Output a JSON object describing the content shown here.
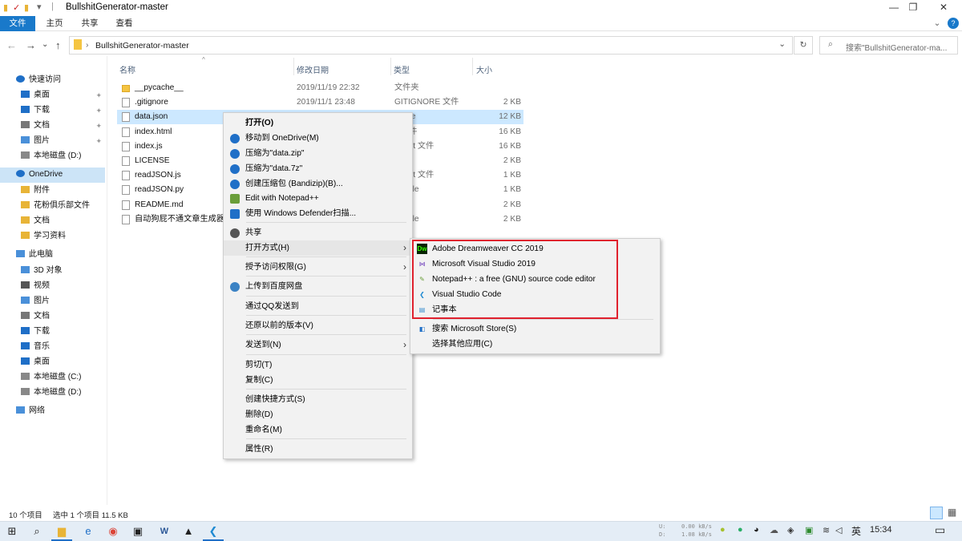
{
  "window": {
    "title": "BullshitGenerator-master",
    "minimize": "—",
    "maximize": "❐",
    "close": "✕"
  },
  "ribbon": {
    "tabs": [
      "文件",
      "主页",
      "共享",
      "查看"
    ],
    "expand": "⌄",
    "help": "?"
  },
  "address": {
    "back": "←",
    "forward": "→",
    "recent": "⌄",
    "up": "↑",
    "path": "BullshitGenerator-master",
    "dropdown": "⌄",
    "refresh": "↻",
    "search_placeholder": "搜索\"BullshitGenerator-ma..."
  },
  "sidebar": {
    "items": [
      {
        "label": "快速访问",
        "icon": "star-icon",
        "pinned": false,
        "level": 0
      },
      {
        "label": "桌面",
        "icon": "desktop-icon",
        "pinned": true,
        "level": 1
      },
      {
        "label": "下载",
        "icon": "download-icon",
        "pinned": true,
        "level": 1
      },
      {
        "label": "文档",
        "icon": "document-icon",
        "pinned": true,
        "level": 1
      },
      {
        "label": "图片",
        "icon": "picture-icon",
        "pinned": true,
        "level": 1
      },
      {
        "label": "本地磁盘 (D:)",
        "icon": "drive-icon",
        "pinned": false,
        "level": 1
      },
      {
        "label": "OneDrive",
        "icon": "cloud-icon",
        "pinned": false,
        "level": 0,
        "selected": true
      },
      {
        "label": "附件",
        "icon": "folder-icon",
        "pinned": false,
        "level": 1
      },
      {
        "label": "花粉俱乐部文件",
        "icon": "folder-icon",
        "pinned": false,
        "level": 1
      },
      {
        "label": "文档",
        "icon": "folder-icon",
        "pinned": false,
        "level": 1
      },
      {
        "label": "学习资料",
        "icon": "folder-icon",
        "pinned": false,
        "level": 1
      },
      {
        "label": "此电脑",
        "icon": "computer-icon",
        "pinned": false,
        "level": 0
      },
      {
        "label": "3D 对象",
        "icon": "cube-icon",
        "pinned": false,
        "level": 1
      },
      {
        "label": "视频",
        "icon": "video-icon",
        "pinned": false,
        "level": 1
      },
      {
        "label": "图片",
        "icon": "picture-icon",
        "pinned": false,
        "level": 1
      },
      {
        "label": "文档",
        "icon": "document-icon",
        "pinned": false,
        "level": 1
      },
      {
        "label": "下载",
        "icon": "download-icon",
        "pinned": false,
        "level": 1
      },
      {
        "label": "音乐",
        "icon": "music-icon",
        "pinned": false,
        "level": 1
      },
      {
        "label": "桌面",
        "icon": "desktop-icon",
        "pinned": false,
        "level": 1
      },
      {
        "label": "本地磁盘 (C:)",
        "icon": "drive-icon",
        "pinned": false,
        "level": 1
      },
      {
        "label": "本地磁盘 (D:)",
        "icon": "drive-icon",
        "pinned": false,
        "level": 1
      },
      {
        "label": "网络",
        "icon": "network-icon",
        "pinned": false,
        "level": 0
      }
    ]
  },
  "columns": {
    "name": "名称",
    "date": "修改日期",
    "type": "类型",
    "size": "大小"
  },
  "files": [
    {
      "name": "__pycache__",
      "date": "2019/11/19 22:32",
      "type": "文件夹",
      "size": "",
      "folder": true
    },
    {
      "name": ".gitignore",
      "date": "2019/11/1 23:48",
      "type": "GITIGNORE 文件",
      "size": "2 KB"
    },
    {
      "name": "data.json",
      "date": "",
      "type": "N File",
      "size": "12 KB",
      "selected": true
    },
    {
      "name": "index.html",
      "date": "",
      "type": "L 文件",
      "size": "16 KB"
    },
    {
      "name": "index.js",
      "date": "",
      "type": "Script 文件",
      "size": "16 KB"
    },
    {
      "name": "LICENSE",
      "date": "",
      "type": "",
      "size": "2 KB"
    },
    {
      "name": "readJSON.js",
      "date": "",
      "type": "Script 文件",
      "size": "1 KB"
    },
    {
      "name": "readJSON.py",
      "date": "",
      "type": "on File",
      "size": "1 KB"
    },
    {
      "name": "README.md",
      "date": "",
      "type": "文件",
      "size": "2 KB"
    },
    {
      "name": "自动狗屁不通文章生成器",
      "date": "",
      "type": "on File",
      "size": "2 KB"
    }
  ],
  "context_menu": {
    "items": [
      {
        "label": "打开(O)",
        "bold": true,
        "icon": ""
      },
      {
        "label": "移动到 OneDrive(M)",
        "icon": "onedrive-icon"
      },
      {
        "label": "压缩为\"data.zip\"",
        "icon": "bandizip-icon"
      },
      {
        "label": "压缩为\"data.7z\"",
        "icon": "bandizip-icon"
      },
      {
        "label": "创建压缩包 (Bandizip)(B)...",
        "icon": "bandizip-icon"
      },
      {
        "label": "Edit with Notepad++",
        "icon": "notepadpp-icon"
      },
      {
        "label": "使用 Windows Defender扫描...",
        "icon": "defender-icon"
      },
      {
        "label": "共享",
        "icon": "share-icon",
        "sep_before": true
      },
      {
        "label": "打开方式(H)",
        "submenu": true,
        "hover": true
      },
      {
        "label": "授予访问权限(G)",
        "submenu": true,
        "sep_before": true
      },
      {
        "label": "上传到百度网盘",
        "icon": "baidu-icon",
        "sep_before": true
      },
      {
        "label": "通过QQ发送到",
        "sep_before": true
      },
      {
        "label": "还原以前的版本(V)",
        "sep_before": true
      },
      {
        "label": "发送到(N)",
        "submenu": true,
        "sep_before": true
      },
      {
        "label": "剪切(T)",
        "sep_before": true
      },
      {
        "label": "复制(C)"
      },
      {
        "label": "创建快捷方式(S)",
        "sep_before": true
      },
      {
        "label": "删除(D)"
      },
      {
        "label": "重命名(M)"
      },
      {
        "label": "属性(R)",
        "sep_before": true
      }
    ],
    "submenu_arrow": "›"
  },
  "open_with": {
    "items": [
      {
        "label": "Adobe Dreamweaver CC 2019",
        "icon": "dreamweaver-icon",
        "glyph": "Dw"
      },
      {
        "label": "Microsoft Visual Studio 2019",
        "icon": "visual-studio-icon",
        "glyph": "⋈"
      },
      {
        "label": "Notepad++ : a free (GNU) source code editor",
        "icon": "notepadpp-icon",
        "glyph": "✎"
      },
      {
        "label": "Visual Studio Code",
        "icon": "vscode-icon",
        "glyph": "❮"
      },
      {
        "label": "记事本",
        "icon": "notepad-icon",
        "glyph": "▤"
      },
      {
        "label": "搜索 Microsoft Store(S)",
        "icon": "store-icon",
        "glyph": "◧",
        "sep_before": true
      },
      {
        "label": "选择其他应用(C)",
        "icon": "",
        "glyph": ""
      }
    ]
  },
  "status": {
    "count": "10 个项目",
    "selection": "选中 1 个项目 11.5 KB"
  },
  "taskbar": {
    "apps": [
      {
        "icon": "windows-start-icon",
        "glyph": "⊞"
      },
      {
        "icon": "search-icon",
        "glyph": "⌕"
      },
      {
        "icon": "file-explorer-icon",
        "glyph": "▆"
      },
      {
        "icon": "edge-icon",
        "glyph": "e"
      },
      {
        "icon": "chrome-icon",
        "glyph": "◉"
      },
      {
        "icon": "store-icon",
        "glyph": "▣"
      },
      {
        "icon": "word-icon",
        "glyph": "W"
      },
      {
        "icon": "photos-icon",
        "glyph": "▲"
      },
      {
        "icon": "vscode-icon",
        "glyph": "❮"
      }
    ],
    "netspeed_up": "0.00 kB/s",
    "netspeed_down": "1.08 kB/s",
    "netspeed_up_label": "U:",
    "netspeed_down_label": "D:",
    "ime": "英",
    "time": "15:34",
    "notification": "▭"
  },
  "colors": {
    "accent": "#1979ca",
    "highlight_box": "#e0212e",
    "selection": "#cce8ff"
  }
}
